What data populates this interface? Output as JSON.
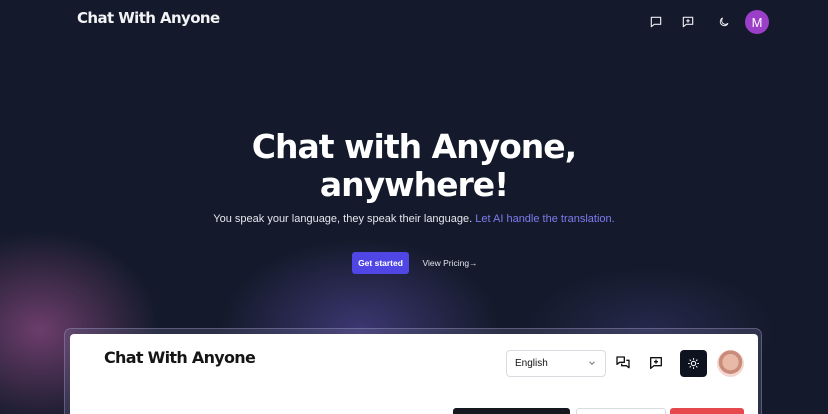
{
  "nav": {
    "brand": "Chat With Anyone",
    "icons": [
      "chat-bubble-icon",
      "new-chat-icon",
      "moon-icon"
    ],
    "avatar_initial": "M",
    "avatar_color": "#9b3fc8"
  },
  "hero": {
    "title_line1": "Chat with Anyone,",
    "title_line2": "anywhere!",
    "subtitle": "You speak your language, they speak their language.",
    "subtitle_accent": "Let AI handle the translation.",
    "accent_color": "#7d7cf0"
  },
  "cta": {
    "primary_label": "Get started",
    "secondary_label": "View Pricing→",
    "primary_color": "#4f46e5"
  },
  "preview": {
    "brand": "Chat With Anyone",
    "language_select": "English",
    "icons": [
      "chats-icon",
      "new-chat-icon",
      "sun-icon"
    ]
  }
}
